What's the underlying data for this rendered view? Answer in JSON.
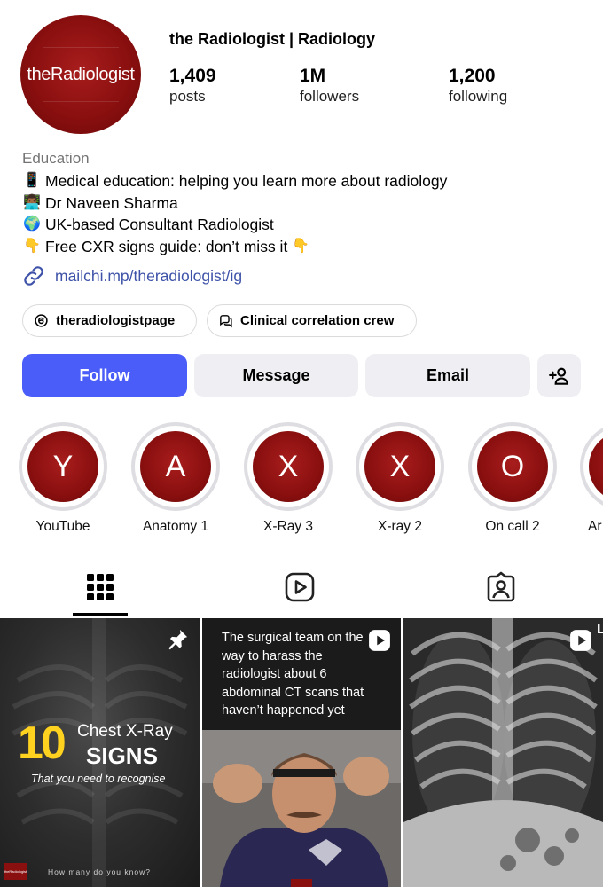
{
  "profile": {
    "avatar_text": "theRadiologist",
    "name": "the Radiologist | Radiology",
    "stats": {
      "posts": {
        "value": "1,409",
        "label": "posts"
      },
      "followers": {
        "value": "1M",
        "label": "followers"
      },
      "following": {
        "value": "1,200",
        "label": "following"
      }
    }
  },
  "bio": {
    "category": "Education",
    "lines": [
      {
        "emoji": "📱",
        "text": "Medical education: helping you learn more about radiology"
      },
      {
        "emoji": "👨🏾‍💻",
        "text": "Dr Naveen Sharma"
      },
      {
        "emoji": "🌍",
        "text": "UK-based Consultant Radiologist"
      },
      {
        "emoji": "👇",
        "text": "Free CXR signs guide: don’t miss it",
        "trailing_emoji": "👇"
      }
    ],
    "link": "mailchi.mp/theradiologist/ig"
  },
  "chips": {
    "threads": "theradiologistpage",
    "channel": "Clinical correlation crew"
  },
  "actions": {
    "follow": "Follow",
    "message": "Message",
    "email": "Email"
  },
  "highlights": [
    {
      "letter": "Y",
      "label": "YouTube"
    },
    {
      "letter": "A",
      "label": "Anatomy 1"
    },
    {
      "letter": "X",
      "label": "X-Ray 3"
    },
    {
      "letter": "X",
      "label": "X-ray 2"
    },
    {
      "letter": "O",
      "label": "On call 2"
    },
    {
      "letter": "",
      "label": "Ar"
    }
  ],
  "posts": {
    "p1": {
      "number": "10",
      "title": "Chest X-Ray",
      "signs": "SIGNS",
      "subtitle": "That you need to recognise",
      "footer": "How many do you know?",
      "logo": "theRadiologist"
    },
    "p2": {
      "text": "The surgical team on the way to harass the radiologist about 6 abdominal CT scans that haven’t happened yet"
    },
    "p3": {
      "corner_letter": "L"
    }
  },
  "colors": {
    "accent": "#4a5df9",
    "brand_red": "#8a0f0f",
    "link": "#3d52a8",
    "button_bg": "#efeff3"
  },
  "icons": {
    "link": "link-icon",
    "threads": "threads-icon",
    "channel": "broadcast-channel-icon",
    "add_user": "add-user-icon",
    "grid": "grid-icon",
    "reels": "reels-icon",
    "tagged": "tagged-icon",
    "pin": "pin-icon",
    "reel_badge": "reel-icon"
  }
}
